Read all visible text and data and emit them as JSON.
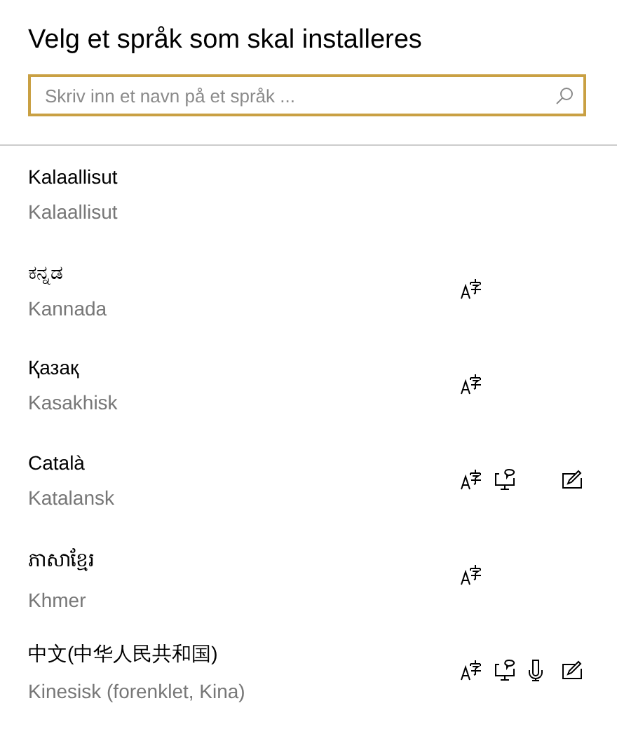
{
  "title": "Velg et språk som skal installeres",
  "search": {
    "placeholder": "Skriv inn et navn på et språk ..."
  },
  "languages": [
    {
      "native": "Kalaallisut",
      "name": "Kalaallisut",
      "features": {
        "display_language": false,
        "text_to_speech": false,
        "speech": false,
        "handwriting": false
      }
    },
    {
      "native": "ಕನ್ನಡ",
      "name": "Kannada",
      "features": {
        "display_language": true,
        "text_to_speech": false,
        "speech": false,
        "handwriting": false
      }
    },
    {
      "native": "Қазақ",
      "name": "Kasakhisk",
      "features": {
        "display_language": true,
        "text_to_speech": false,
        "speech": false,
        "handwriting": false
      }
    },
    {
      "native": "Català",
      "name": "Katalansk",
      "features": {
        "display_language": true,
        "text_to_speech": true,
        "speech": false,
        "handwriting": true
      }
    },
    {
      "native": "ភាសាខ្មែរ",
      "name": "Khmer",
      "features": {
        "display_language": true,
        "text_to_speech": false,
        "speech": false,
        "handwriting": false
      }
    },
    {
      "native": "中文(中华人民共和国)",
      "name": "Kinesisk (forenklet, Kina)",
      "features": {
        "display_language": true,
        "text_to_speech": true,
        "speech": true,
        "handwriting": true
      }
    }
  ]
}
